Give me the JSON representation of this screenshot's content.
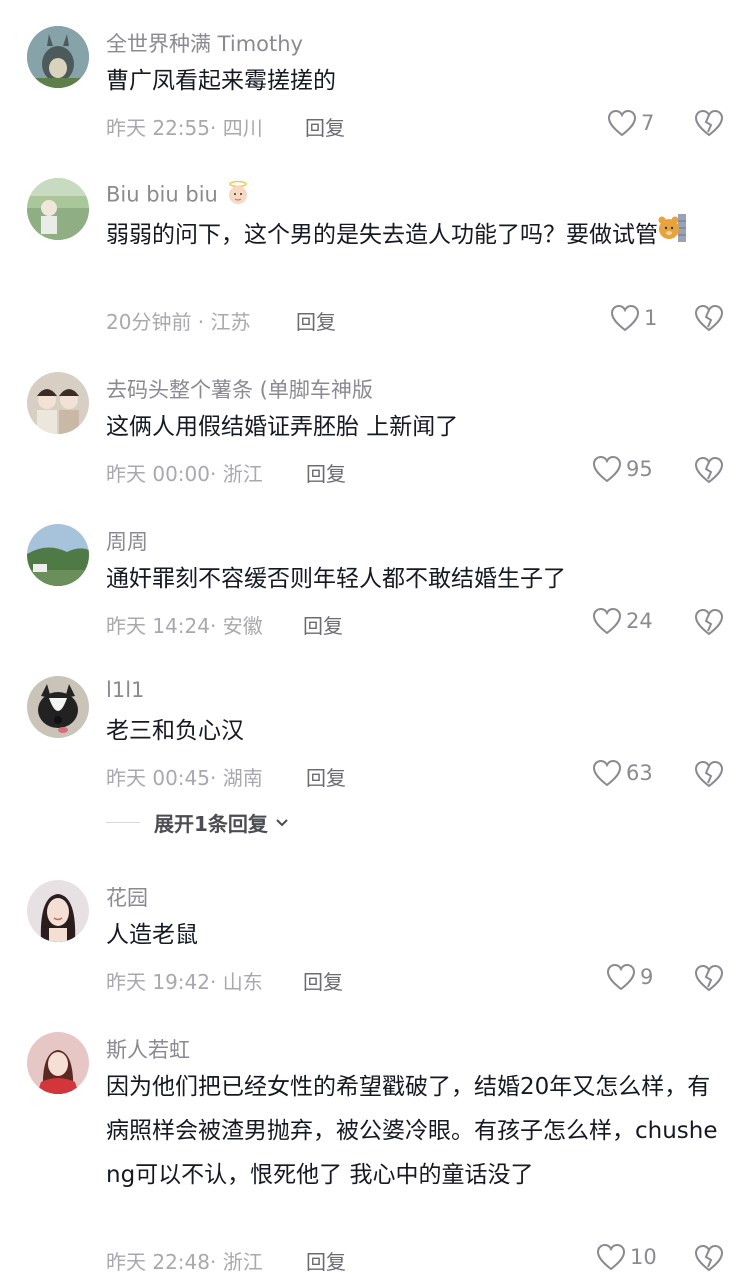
{
  "comments": [
    {
      "username": "全世界种满 Timothy",
      "text": "曹广凤看起来霉搓搓的",
      "time": "昨天 22:55",
      "location": "四川",
      "reply": "回复",
      "likes": "7",
      "avatar_icon": "totoro-avatar"
    },
    {
      "username": "Biu biu biu",
      "username_emoji": "angel-baby-emoji",
      "text": "弱弱的问下，这个男的是失去造人功能了吗？要做试管",
      "text_emoji": "bear-peeking-emoji",
      "time": "20分钟前",
      "location": "江苏",
      "reply": "回复",
      "likes": "1",
      "avatar_icon": "garden-avatar"
    },
    {
      "username": "去码头整个薯条 (单脚车神版",
      "text": "这俩人用假结婚证弄胚胎 上新闻了",
      "time": "昨天 00:00",
      "location": "浙江",
      "reply": "回复",
      "likes": "95",
      "avatar_icon": "two-girls-avatar"
    },
    {
      "username": "周周",
      "text": "通奸罪刻不容缓否则年轻人都不敢结婚生子了",
      "time": "昨天 14:24",
      "location": "安徽",
      "reply": "回复",
      "likes": "24",
      "avatar_icon": "landscape-avatar"
    },
    {
      "username": "l1l1",
      "text": "老三和负心汉",
      "time": "昨天 00:45",
      "location": "湖南",
      "reply": "回复",
      "likes": "63",
      "avatar_icon": "dog-avatar",
      "expand": "展开1条回复"
    },
    {
      "username": "花园",
      "text": "人造老鼠",
      "time": "昨天 19:42",
      "location": "山东",
      "reply": "回复",
      "likes": "9",
      "avatar_icon": "girl-portrait-avatar"
    },
    {
      "username": "斯人若虹",
      "text": "因为他们把已经女性的希望戳破了，结婚20年又怎么样，有病照样会被渣男抛弃，被公婆冷眼。有孩子怎么样，chusheng可以不认，恨死他了 我心中的童话没了",
      "time": "昨天 22:48",
      "location": "浙江",
      "reply": "回复",
      "likes": "10",
      "avatar_icon": "red-dress-avatar"
    }
  ]
}
